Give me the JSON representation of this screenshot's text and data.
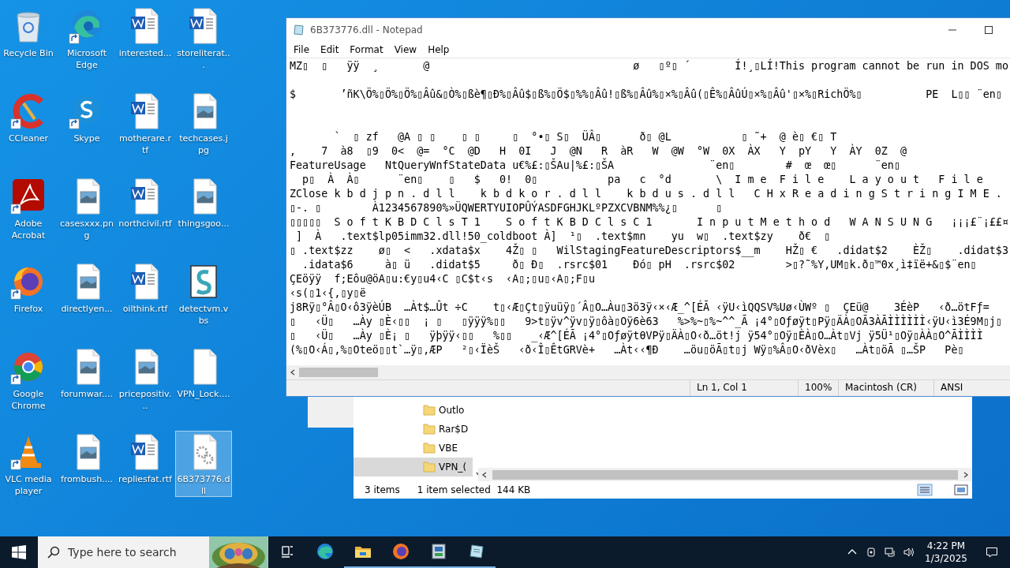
{
  "desktop": {
    "icons": [
      {
        "label": "Recycle Bin",
        "kind": "recycle",
        "shortcut": false,
        "selected": false
      },
      {
        "label": "Microsoft Edge",
        "kind": "edge",
        "shortcut": true,
        "selected": false
      },
      {
        "label": "interested...",
        "kind": "word",
        "shortcut": false,
        "selected": false
      },
      {
        "label": "storeliterat...",
        "kind": "word",
        "shortcut": false,
        "selected": false
      },
      {
        "label": "CCleaner",
        "kind": "ccleaner",
        "shortcut": true,
        "selected": false
      },
      {
        "label": "Skype",
        "kind": "skype",
        "shortcut": true,
        "selected": false
      },
      {
        "label": "motherare.rtf",
        "kind": "word",
        "shortcut": false,
        "selected": false
      },
      {
        "label": "techcases.jpg",
        "shortcut": false,
        "selected": false
      },
      {
        "label": "Adobe Acrobat",
        "kind": "acrobat",
        "shortcut": true,
        "selected": false
      },
      {
        "label": "casesxxx.png",
        "shortcut": false,
        "selected": false
      },
      {
        "label": "northcivil.rtf",
        "kind": "word",
        "shortcut": false,
        "selected": false
      },
      {
        "label": "thingsgoo...",
        "shortcut": false,
        "selected": false
      },
      {
        "label": "Firefox",
        "kind": "firefox",
        "shortcut": true,
        "selected": false
      },
      {
        "label": "directlyen...",
        "shortcut": false,
        "selected": false
      },
      {
        "label": "oilthink.rtf",
        "kind": "word",
        "shortcut": false,
        "selected": false
      },
      {
        "label": "detectvm.vbs",
        "kind": "script",
        "shortcut": false,
        "selected": false
      },
      {
        "label": "Google Chrome",
        "kind": "chrome",
        "shortcut": true,
        "selected": false
      },
      {
        "label": "forumwar....",
        "shortcut": false,
        "selected": false
      },
      {
        "label": "pricepositiv...",
        "shortcut": false,
        "selected": false
      },
      {
        "label": "VPN_Lock....",
        "kind": "blank",
        "shortcut": false,
        "selected": false
      },
      {
        "label": "VLC media player",
        "kind": "vlc",
        "shortcut": true,
        "selected": false
      },
      {
        "label": "frombush....",
        "shortcut": false,
        "selected": false
      },
      {
        "label": "repliesfat.rtf",
        "kind": "word",
        "shortcut": false,
        "selected": false
      },
      {
        "label": "6B373776.dll",
        "kind": "dll",
        "shortcut": false,
        "selected": true
      }
    ]
  },
  "explorer": {
    "tree_items": [
      {
        "label": "Outlo",
        "selected": false
      },
      {
        "label": "Rar$D",
        "selected": false
      },
      {
        "label": "VBE",
        "selected": false
      },
      {
        "label": "VPN_(",
        "selected": true
      }
    ],
    "status": {
      "count": "3 items",
      "selection": "1 item selected",
      "size": "144 KB"
    }
  },
  "notepad": {
    "title": "6B373776.dll - Notepad",
    "menu": [
      "File",
      "Edit",
      "Format",
      "View",
      "Help"
    ],
    "lines": [
      {
        "kind": "text",
        "text": "MZ▯  ▯   ÿÿ  ¸       @                                ø   ▯º▯ ´       Í!¸▯LÍ!This program cannot be run in DOS mo"
      },
      {
        "kind": "blank"
      },
      {
        "kind": "text",
        "text": "$       ’ñK\\Ö%▯Ö%▯Ö%▯Âû&▯Ò%▯ßè¶▯Ð%▯Âû$▯ß%▯Ö$▯%%▯Âû!▯ß%▯Âû%▯×%▯Âû(▯Ê%▯ÂûÚ▯×%▯Âû'▯×%▯RichÖ%▯          PE  L▯▯ ¨en▯"
      },
      {
        "kind": "blank"
      },
      {
        "kind": "blank"
      },
      {
        "kind": "text",
        "text": "       `  ▯ zf   @A ▯ ▯    ▯ ▯     ▯  °•▯ S▯  ÜÂ▯      ð▯ @L           ▯ ˜+  @ è▯ €▯ T"
      },
      {
        "kind": "text",
        "text": ",    7  à8  ▯9  0<  @=  °C  @D   H  0I   J  @N   R  àR   W  @W  °W  0X  ÀX   Y  pY   Y  ÀY  0Z  @"
      },
      {
        "kind": "text",
        "text": "FeatureUsage   NtQueryWnfStateData u€%£:▯ŠAu|%£:▯ŠA               ¨en▯        #  œ  œ▯      ¨en▯"
      },
      {
        "kind": "text",
        "text": "  p▯  À  À▯      ¨en▯    ▯   $   0!  0▯           pa   c  °d       \\  I m e  F i l e    L a y o u t   F i l e"
      },
      {
        "kind": "text",
        "text": "ZClose k b d j p n . d l l    k b d k o r . d l l    k b d u s . d l l   C H x R e a d i n g S t r i n g I M E ."
      },
      {
        "kind": "text",
        "text": "▯-. ▯        À1234567890%»ÜQWERTYUIOPÛÝASDFGHJKLºPZXCVBNM%%¿▯      ▯"
      },
      {
        "kind": "text",
        "text": "▯▯▯▯▯  S o f t K B D C l s T 1    S o f t K B D C l s C 1       I n p u t M e t h o d   W A N S U N G   ¡¡¡£¨¡££¤"
      },
      {
        "kind": "text",
        "text": " ]  À   .text$lp05imm32.dll!50_coldboot À]  ¹▯  .text$mn    yu  w▯  .text$zy    ð€  ▯"
      },
      {
        "kind": "text",
        "text": "▯ .text$zz    ø▯  <   .xdata$x    4Ž▯ ▯   WilStagingFeatureDescriptors$__m    HŽ▯ €   .didat$2    ÈŽ▯    .didat$3"
      },
      {
        "kind": "text",
        "text": "  .idata$6     à▯ ü   .didat$5     ð▯ Ð▯  .rsrc$01    Ðó▯ pH  .rsrc$02        >▯?˜%Y,UM▯k.ð▯™Θx¸ì‡ïë+&▯$¨en▯"
      },
      {
        "kind": "text",
        "text": "ÇEöÿÿ  f;Eôu@öA▯u:€y▯u4‹C ▯C$t‹s  ‹A▯;▯u▯‹A▯;F▯u"
      },
      {
        "kind": "text",
        "text": "‹s(▯1‹{,▯y▯ë"
      },
      {
        "kind": "text",
        "text": "j8Rÿ▯°Â▯O‹ô3ÿèÚB  …Àt$…Ût ÷C    t▯‹Æ▯Çt▯ÿuüÿ▯´Â▯O…Àu▯3ö3ÿ‹×‹Æ_^[ÉÃ ‹ÿU‹ìQQSV%Uø‹ÙWº ▯  ÇEü@    3ÉèP   ‹ð…ötFƒ="
      },
      {
        "kind": "text",
        "text": "▯   ‹Ü▯   …Ày ▯È‹▯▯  ¡ ▯   ▯ÿÿÿ%▯▯   9>t▯ÿv^ÿv▯ÿ▯ôà▯Oÿ6è63   %>%~▯%~^^_Ã ¡4°▯Oƒøÿt▯Pÿ▯ÄÀ▯OÃ3ÀÃÌÌÌÌÌÌ‹ÿU‹ì3É9M▯j▯"
      },
      {
        "kind": "text",
        "text": "▯   ‹Ü▯   …Ày ▯È¡ ▯   ÿþÿÿ‹▯▯   %▯▯   _‹Æ^[ÉÃ ¡4°▯OƒøÿtθVPÿ▯ÄÀ▯O‹ð…öt!j ÿ54°▯Oÿ▯ÈÀ▯O…Àt▯Vj ÿ5Ü¹▯Oÿ▯ÀÀ▯O^ÃÌÌÌÌ"
      },
      {
        "kind": "text",
        "text": "(%▯O‹Á▯,%▯Oteö▯▯t`…ÿ▯,ÆP   ²▯‹ÏèŠ   ‹ð‹Î▯ÊtGRVè+   …Àt‹‹¶Ð    …öu▯öÃ▯t▯j Wÿ▯%Â▯O‹ðVèx▯   …Àt▯öÃ ▯…ŠP   Pè▯"
      }
    ],
    "status": {
      "position": "Ln 1, Col 1",
      "zoom": "100%",
      "line_endings": "Macintosh (CR)",
      "encoding": "ANSI"
    }
  },
  "taskbar": {
    "search_placeholder": "Type here to search",
    "apps": [
      {
        "kind": "task-view",
        "running": false
      },
      {
        "kind": "edge",
        "running": false
      },
      {
        "kind": "explorer",
        "running": true
      },
      {
        "kind": "firefox",
        "running": true
      },
      {
        "kind": "installer",
        "running": true
      },
      {
        "kind": "notepad",
        "running": true
      }
    ],
    "time": "4:22 PM",
    "date": "1/3/2025"
  }
}
